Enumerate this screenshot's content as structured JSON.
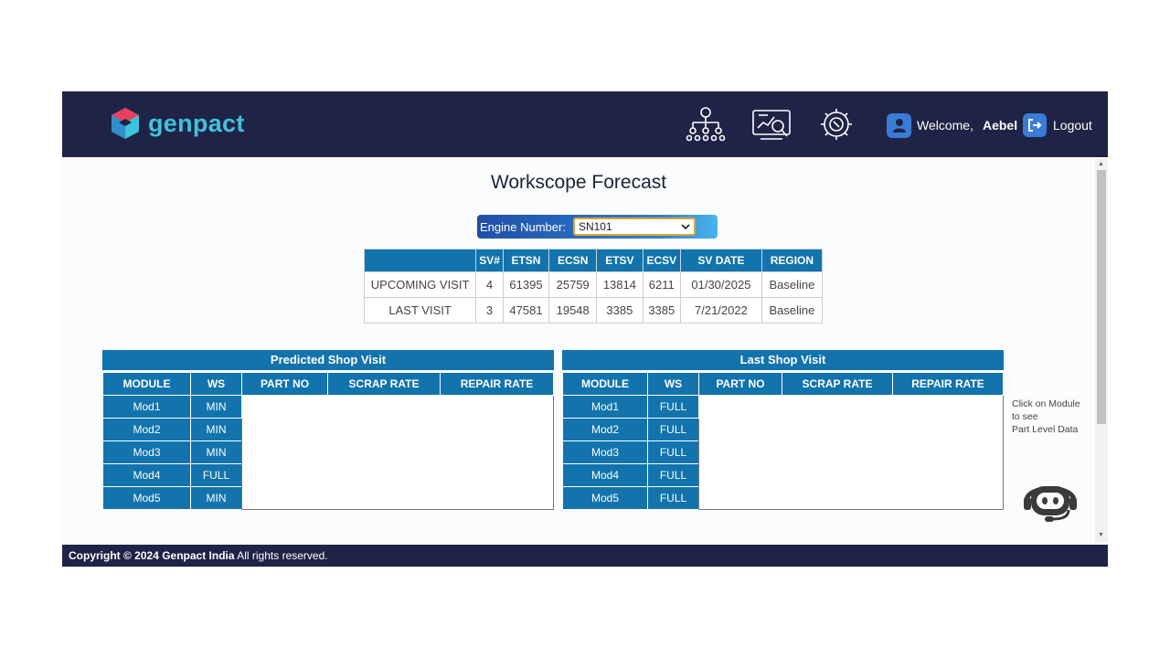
{
  "header": {
    "brand": "genpact",
    "welcome_label": "Welcome,",
    "username": "Aebel",
    "logout_label": "Logout",
    "icons": [
      "org-hierarchy-icon",
      "analytics-dashboard-icon",
      "settings-gear-icon"
    ]
  },
  "page": {
    "title": "Workscope Forecast",
    "engine_label": "Engine Number:",
    "engine_value": "SN101"
  },
  "visits": {
    "headers": [
      "",
      "SV#",
      "ETSN",
      "ECSN",
      "ETSV",
      "ECSV",
      "SV DATE",
      "REGION"
    ],
    "rows": [
      [
        "UPCOMING VISIT",
        "4",
        "61395",
        "25759",
        "13814",
        "6211",
        "01/30/2025",
        "Baseline"
      ],
      [
        "LAST VISIT",
        "3",
        "47581",
        "19548",
        "3385",
        "3385",
        "7/21/2022",
        "Baseline"
      ]
    ]
  },
  "predicted": {
    "title": "Predicted Shop Visit",
    "headers": [
      "MODULE",
      "WS",
      "PART NO",
      "SCRAP RATE",
      "REPAIR RATE"
    ],
    "rows": [
      [
        "Mod1",
        "MIN"
      ],
      [
        "Mod2",
        "MIN"
      ],
      [
        "Mod3",
        "MIN"
      ],
      [
        "Mod4",
        "FULL"
      ],
      [
        "Mod5",
        "MIN"
      ]
    ]
  },
  "last": {
    "title": "Last Shop Visit",
    "headers": [
      "MODULE",
      "WS",
      "PART NO",
      "SCRAP RATE",
      "REPAIR RATE"
    ],
    "rows": [
      [
        "Mod1",
        "FULL"
      ],
      [
        "Mod2",
        "FULL"
      ],
      [
        "Mod3",
        "FULL"
      ],
      [
        "Mod4",
        "FULL"
      ],
      [
        "Mod5",
        "FULL"
      ]
    ]
  },
  "hint": [
    "Click on Module",
    "to see",
    "Part Level Data"
  ],
  "footer": {
    "copyright": "Copyright © 2024 Genpact India",
    "rights": "All rights reserved."
  },
  "colors": {
    "header_bg": "#1f2346",
    "table_header": "#1273ad",
    "brand_accent": "#3ec3dc"
  }
}
